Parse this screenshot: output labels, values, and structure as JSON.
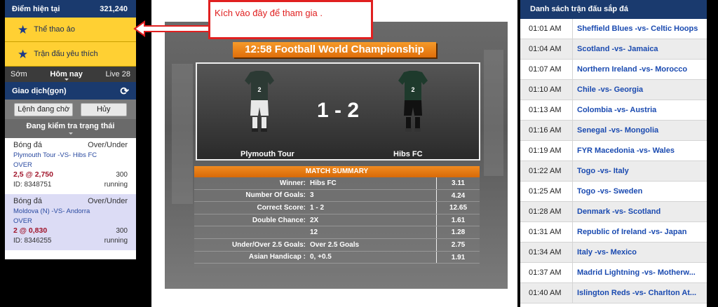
{
  "left": {
    "balance_label": "Điểm hiện tại",
    "balance_value": "321,240",
    "virtual_sports": "Thể thao ảo",
    "favorite_matches": "Trận đấu yêu thích",
    "tabs": [
      "Sớm",
      "Hôm nay",
      "Live 28"
    ],
    "trade_label": "Giao dịch(gọn)",
    "pending_button": "Lệnh đang chờ",
    "cancel_button": "Hủy",
    "status_label": "Đang kiểm tra trạng thái",
    "bets": [
      {
        "sport": "Bóng đá",
        "market": "Over/Under",
        "match": "Plymouth Tour -VS- Hibs FC",
        "selection": "OVER",
        "line": "2,5",
        "price": "2,750",
        "stake": "300",
        "id": "ID: 8348751",
        "status": "running"
      },
      {
        "sport": "Bóng đá",
        "market": "Over/Under",
        "match": "Moldova (N) -VS- Andorra",
        "selection": "OVER",
        "line": "2",
        "price": "0,830",
        "stake": "300",
        "id": "ID: 8346255",
        "status": "running"
      }
    ]
  },
  "callout": "Kích vào đây để tham gia .",
  "game": {
    "title": "12:58  Football World Championship",
    "home_team": "Plymouth Tour",
    "away_team": "Hibs FC",
    "score": "1 - 2",
    "home_shirt_number": "2",
    "away_shirt_number": "2",
    "summary_title": "MATCH SUMMARY",
    "summary": [
      {
        "label": "Winner:",
        "value": "Hibs FC",
        "odds": "3.11"
      },
      {
        "label": "Number Of Goals:",
        "value": "3",
        "odds": "4.24"
      },
      {
        "label": "Correct Score:",
        "value": "1 - 2",
        "odds": "12.65"
      },
      {
        "label": "Double Chance:",
        "value": "2X",
        "odds": "1.61"
      },
      {
        "label": "",
        "value": "12",
        "odds": "1.28"
      },
      {
        "label": "Under/Over 2.5 Goals:",
        "value": "Over 2.5 Goals",
        "odds": "2.75"
      },
      {
        "label": "Asian Handicap :",
        "value": "0, +0.5",
        "odds": "1.91"
      }
    ]
  },
  "right": {
    "header": "Danh sách trận đấu sắp đá",
    "matches": [
      {
        "time": "01:01 AM",
        "match": "Sheffield Blues -vs- Celtic Hoops"
      },
      {
        "time": "01:04 AM",
        "match": "Scotland -vs- Jamaica"
      },
      {
        "time": "01:07 AM",
        "match": "Northern Ireland -vs- Morocco"
      },
      {
        "time": "01:10 AM",
        "match": "Chile -vs- Georgia"
      },
      {
        "time": "01:13 AM",
        "match": "Colombia -vs- Austria"
      },
      {
        "time": "01:16 AM",
        "match": "Senegal -vs- Mongolia"
      },
      {
        "time": "01:19 AM",
        "match": "FYR Macedonia -vs- Wales"
      },
      {
        "time": "01:22 AM",
        "match": "Togo -vs- Italy"
      },
      {
        "time": "01:25 AM",
        "match": "Togo -vs- Sweden"
      },
      {
        "time": "01:28 AM",
        "match": "Denmark -vs- Scotland"
      },
      {
        "time": "01:31 AM",
        "match": "Republic of Ireland -vs- Japan"
      },
      {
        "time": "01:34 AM",
        "match": "Italy -vs- Mexico"
      },
      {
        "time": "01:37 AM",
        "match": "Madrid Lightning -vs- Motherw..."
      },
      {
        "time": "01:40 AM",
        "match": "Islington Reds -vs- Charlton At..."
      }
    ]
  },
  "colors": {
    "navy": "#1a3a6e",
    "yellow": "#ffd033",
    "orange": "#e8781a",
    "link": "#1a4ab0",
    "red": "#e02020"
  }
}
